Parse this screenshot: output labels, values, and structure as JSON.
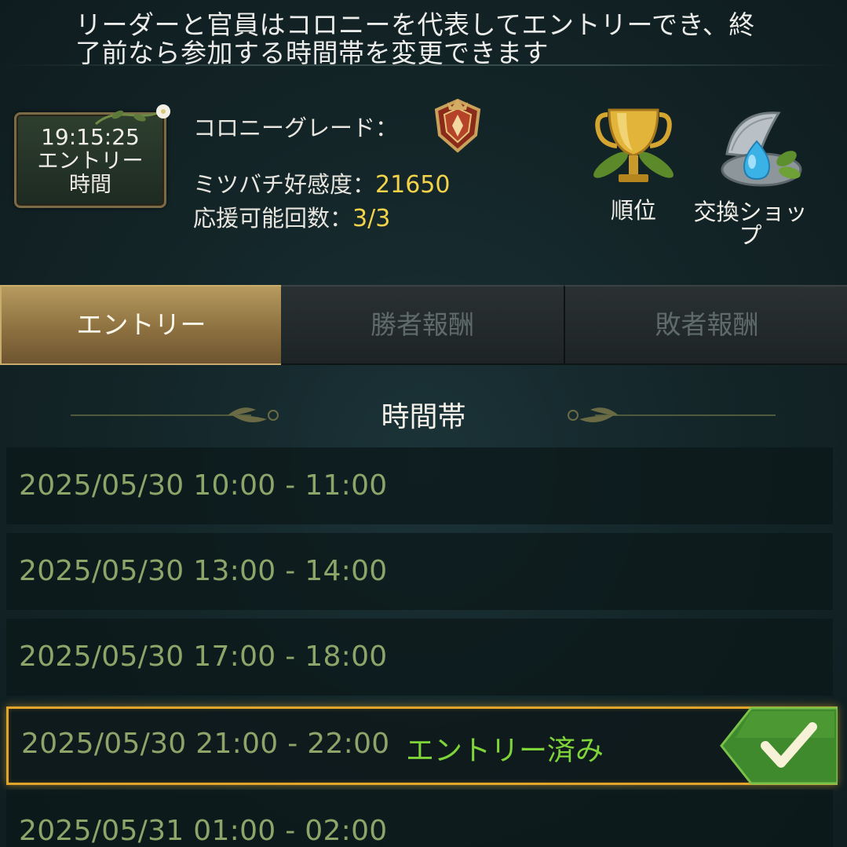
{
  "notice": {
    "line1": "リーダーと官員はコロニーを代表してエントリーでき、終",
    "line2": "了前なら参加する時間帯を変更できます"
  },
  "timer": {
    "time": "19:15:25",
    "label_line1": "エントリー",
    "label_line2": "時間"
  },
  "colony": {
    "grade_label": "コロニーグレード：",
    "grade_icon": "shield-crest-icon",
    "favor_label": "ミツバチ好感度：",
    "favor_value": "21650",
    "support_label": "応援可能回数：",
    "support_value": "3/3"
  },
  "side_buttons": {
    "ranking": {
      "label": "順位",
      "icon": "trophy-icon"
    },
    "shop": {
      "label_line1": "交換ショッ",
      "label_line2": "プ",
      "icon": "shell-pearl-icon"
    }
  },
  "tabs": [
    {
      "label": "エントリー",
      "active": true
    },
    {
      "label": "勝者報酬",
      "active": false
    },
    {
      "label": "敗者報酬",
      "active": false
    }
  ],
  "section_title": "時間帯",
  "slots": [
    {
      "range": "2025/05/30 10:00 - 11:00",
      "status": ""
    },
    {
      "range": "2025/05/30 13:00 - 14:00",
      "status": ""
    },
    {
      "range": "2025/05/30 17:00 - 18:00",
      "status": ""
    },
    {
      "range": "2025/05/30 21:00 - 22:00",
      "status": "エントリー済み"
    },
    {
      "range": "2025/05/31 01:00 - 02:00",
      "status": ""
    }
  ],
  "colors": {
    "accent_gold": "#f2d34a",
    "slot_text": "#8ea56a",
    "entered_status": "#7fd43a",
    "entered_border": "#e2a52c"
  }
}
